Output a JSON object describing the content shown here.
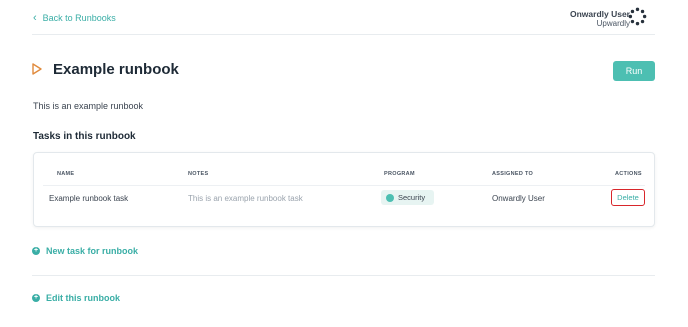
{
  "header": {
    "back_label": "Back to Runbooks",
    "user_name": "Onwardly User",
    "org_name": "Upwardly"
  },
  "runbook": {
    "title": "Example runbook",
    "run_label": "Run",
    "description": "This is an example runbook"
  },
  "tasks": {
    "section_title": "Tasks in this runbook",
    "columns": [
      "NAME",
      "NOTES",
      "PROGRAM",
      "ASSIGNED TO",
      "ACTIONS"
    ],
    "rows": [
      {
        "name": "Example runbook task",
        "notes": "This is an example runbook task",
        "program": "Security",
        "assigned_to": "Onwardly User",
        "action": "Delete"
      }
    ]
  },
  "actions": {
    "new_task_label": "New task for runbook",
    "edit_label": "Edit this runbook"
  },
  "colors": {
    "accent": "#4dbfb2",
    "link": "#3aaea6",
    "highlight_border": "#d8262b",
    "play_icon": "#e08a3c"
  }
}
